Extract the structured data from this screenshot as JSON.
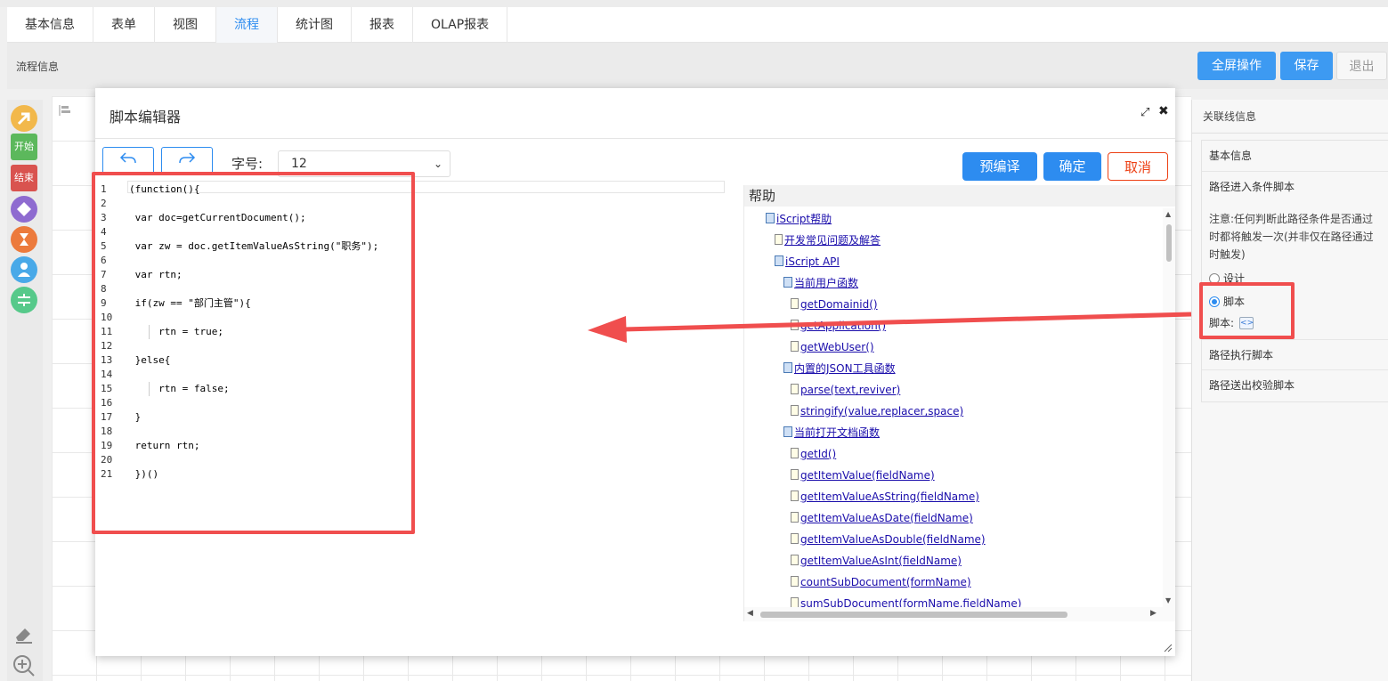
{
  "tabs": [
    {
      "label": "基本信息"
    },
    {
      "label": "表单"
    },
    {
      "label": "视图"
    },
    {
      "label": "流程",
      "active": true
    },
    {
      "label": "统计图"
    },
    {
      "label": "报表"
    },
    {
      "label": "OLAP报表"
    }
  ],
  "header": {
    "title": "流程信息",
    "fullscreen_label": "全屏操作",
    "save_label": "保存",
    "exit_label": "退出"
  },
  "palette": {
    "start_label": "开始",
    "end_label": "结束"
  },
  "modal": {
    "title": "脚本编辑器",
    "font_size_label": "字号:",
    "font_size_value": "12",
    "precompile_label": "预编译",
    "ok_label": "确定",
    "cancel_label": "取消"
  },
  "code": {
    "lines": [
      {
        "n": "1",
        "text": "(function(){"
      },
      {
        "n": "2",
        "text": ""
      },
      {
        "n": "3",
        "text": " var doc=getCurrentDocument();"
      },
      {
        "n": "4",
        "text": ""
      },
      {
        "n": "5",
        "text": " var zw = doc.getItemValueAsString(\"职务\");"
      },
      {
        "n": "6",
        "text": ""
      },
      {
        "n": "7",
        "text": " var rtn;"
      },
      {
        "n": "8",
        "text": ""
      },
      {
        "n": "9",
        "text": " if(zw == \"部门主管\"){"
      },
      {
        "n": "10",
        "text": ""
      },
      {
        "n": "11",
        "text": "     rtn = true;"
      },
      {
        "n": "12",
        "text": ""
      },
      {
        "n": "13",
        "text": " }else{"
      },
      {
        "n": "14",
        "text": ""
      },
      {
        "n": "15",
        "text": "     rtn = false;"
      },
      {
        "n": "16",
        "text": ""
      },
      {
        "n": "17",
        "text": " }"
      },
      {
        "n": "18",
        "text": ""
      },
      {
        "n": "19",
        "text": " return rtn;"
      },
      {
        "n": "20",
        "text": ""
      },
      {
        "n": "21",
        "text": " })()"
      }
    ]
  },
  "help": {
    "title": "帮助",
    "nodes": [
      {
        "label": "iScript帮助",
        "icon": "book-icon",
        "level": 0
      },
      {
        "label": "开发常见问题及解答",
        "icon": "file-icon",
        "level": 1
      },
      {
        "label": "iScript API",
        "icon": "book-icon",
        "level": 1
      },
      {
        "label": "当前用户函数",
        "icon": "book-icon",
        "level": 2
      },
      {
        "label": "getDomainid()",
        "icon": "file-icon",
        "level": 3
      },
      {
        "label": "getApplication()",
        "icon": "file-icon",
        "level": 3
      },
      {
        "label": "getWebUser()",
        "icon": "file-icon",
        "level": 3
      },
      {
        "label": "内置的JSON工具函数",
        "icon": "book-icon",
        "level": 2
      },
      {
        "label": "parse(text,reviver)",
        "icon": "file-icon",
        "level": 3
      },
      {
        "label": "stringify(value,replacer,space)",
        "icon": "file-icon",
        "level": 3
      },
      {
        "label": "当前打开文档函数",
        "icon": "book-icon",
        "level": 2
      },
      {
        "label": "getId()",
        "icon": "file-icon",
        "level": 3
      },
      {
        "label": "getItemValue(fieldName)",
        "icon": "file-icon",
        "level": 3
      },
      {
        "label": "getItemValueAsString(fieldName)",
        "icon": "file-icon",
        "level": 3
      },
      {
        "label": "getItemValueAsDate(fieldName)",
        "icon": "file-icon",
        "level": 3
      },
      {
        "label": "getItemValueAsDouble(fieldName)",
        "icon": "file-icon",
        "level": 3
      },
      {
        "label": "getItemValueAsInt(fieldName)",
        "icon": "file-icon",
        "level": 3
      },
      {
        "label": "countSubDocument(formName)",
        "icon": "file-icon",
        "level": 3
      },
      {
        "label": "sumSubDocument(formName,fieldName)",
        "icon": "file-icon",
        "level": 3
      }
    ]
  },
  "right_panel": {
    "title": "关联线信息",
    "basic_info": "基本信息",
    "enter_condition": "路径进入条件脚本",
    "note": "注意:任何判断此路径条件是否通过时都将触发一次(并非仅在路径通过时触发)",
    "radio_design": "设计",
    "radio_script": "脚本",
    "script_label": "脚本:",
    "exec_script": "路径执行脚本",
    "validate_script": "路径送出校验脚本"
  },
  "colors": {
    "accent": "#2d8cf0",
    "annotation": "#f04e4e"
  }
}
